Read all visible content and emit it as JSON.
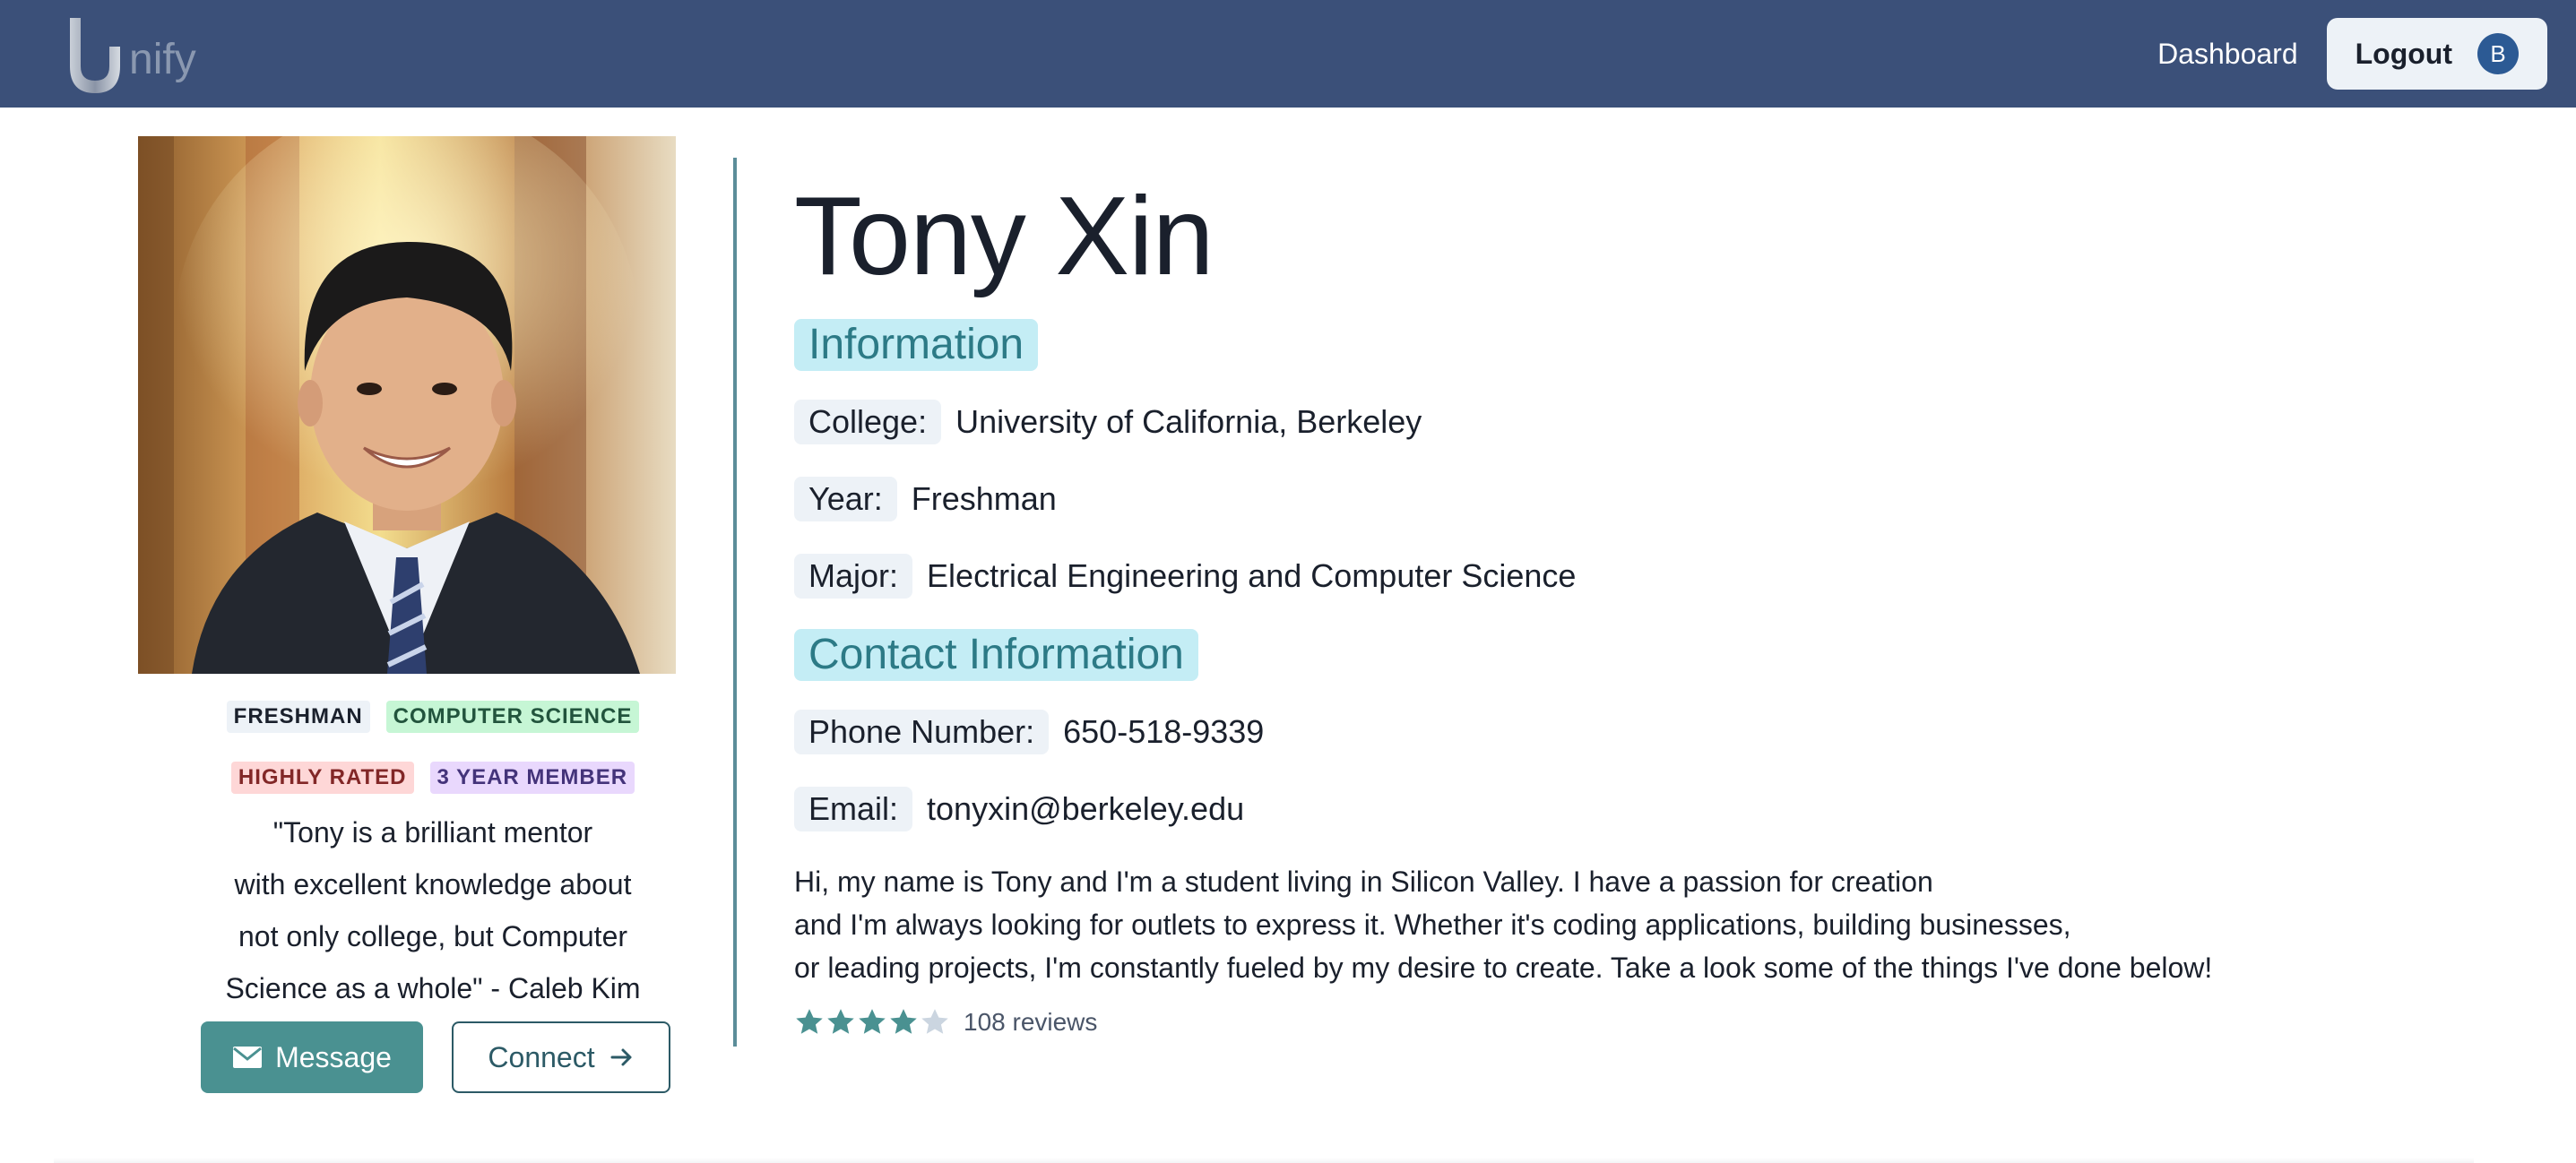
{
  "navbar": {
    "logo_letter": "U",
    "logo_text": "nify",
    "dashboard_label": "Dashboard",
    "logout_label": "Logout",
    "avatar_initial": "B",
    "bg_color": "#3b5079"
  },
  "profile": {
    "name": "Tony Xin",
    "photo_icon": "profile-photo",
    "badges_row1": [
      "FRESHMAN",
      "COMPUTER SCIENCE"
    ],
    "badges_row2": [
      "HIGHLY RATED",
      "3 YEAR MEMBER"
    ],
    "quote_lines": [
      "\"Tony is a brilliant mentor",
      "with excellent knowledge about",
      "not only college, but Computer",
      "Science as a whole\" - Caleb Kim"
    ],
    "message_label": "Message",
    "connect_label": "Connect"
  },
  "information": {
    "heading": "Information",
    "college_label": "College:",
    "college_value": "University of California, Berkeley",
    "year_label": "Year:",
    "year_value": "Freshman",
    "major_label": "Major:",
    "major_value": "Electrical Engineering and Computer Science"
  },
  "contact": {
    "heading": "Contact Information",
    "phone_label": "Phone Number:",
    "phone_value": "650-518-9339",
    "email_label": "Email:",
    "email_value": "tonyxin@berkeley.edu"
  },
  "bio_lines": [
    "Hi, my name is Tony and I'm a student living in Silicon Valley. I have a passion for creation",
    "and I'm always looking for outlets to express it. Whether it's coding applications, building businesses,",
    "or leading projects, I'm constantly fueled by my desire to create. Take a look some of the things I've done below!"
  ],
  "rating": {
    "stars_filled": 4,
    "stars_total": 5,
    "reviews_text": "108 reviews"
  },
  "colors": {
    "accent": "#4a9191",
    "heading_bg": "#c4edf5",
    "heading_text": "#2c7a86",
    "divider": "#5b8d99"
  }
}
